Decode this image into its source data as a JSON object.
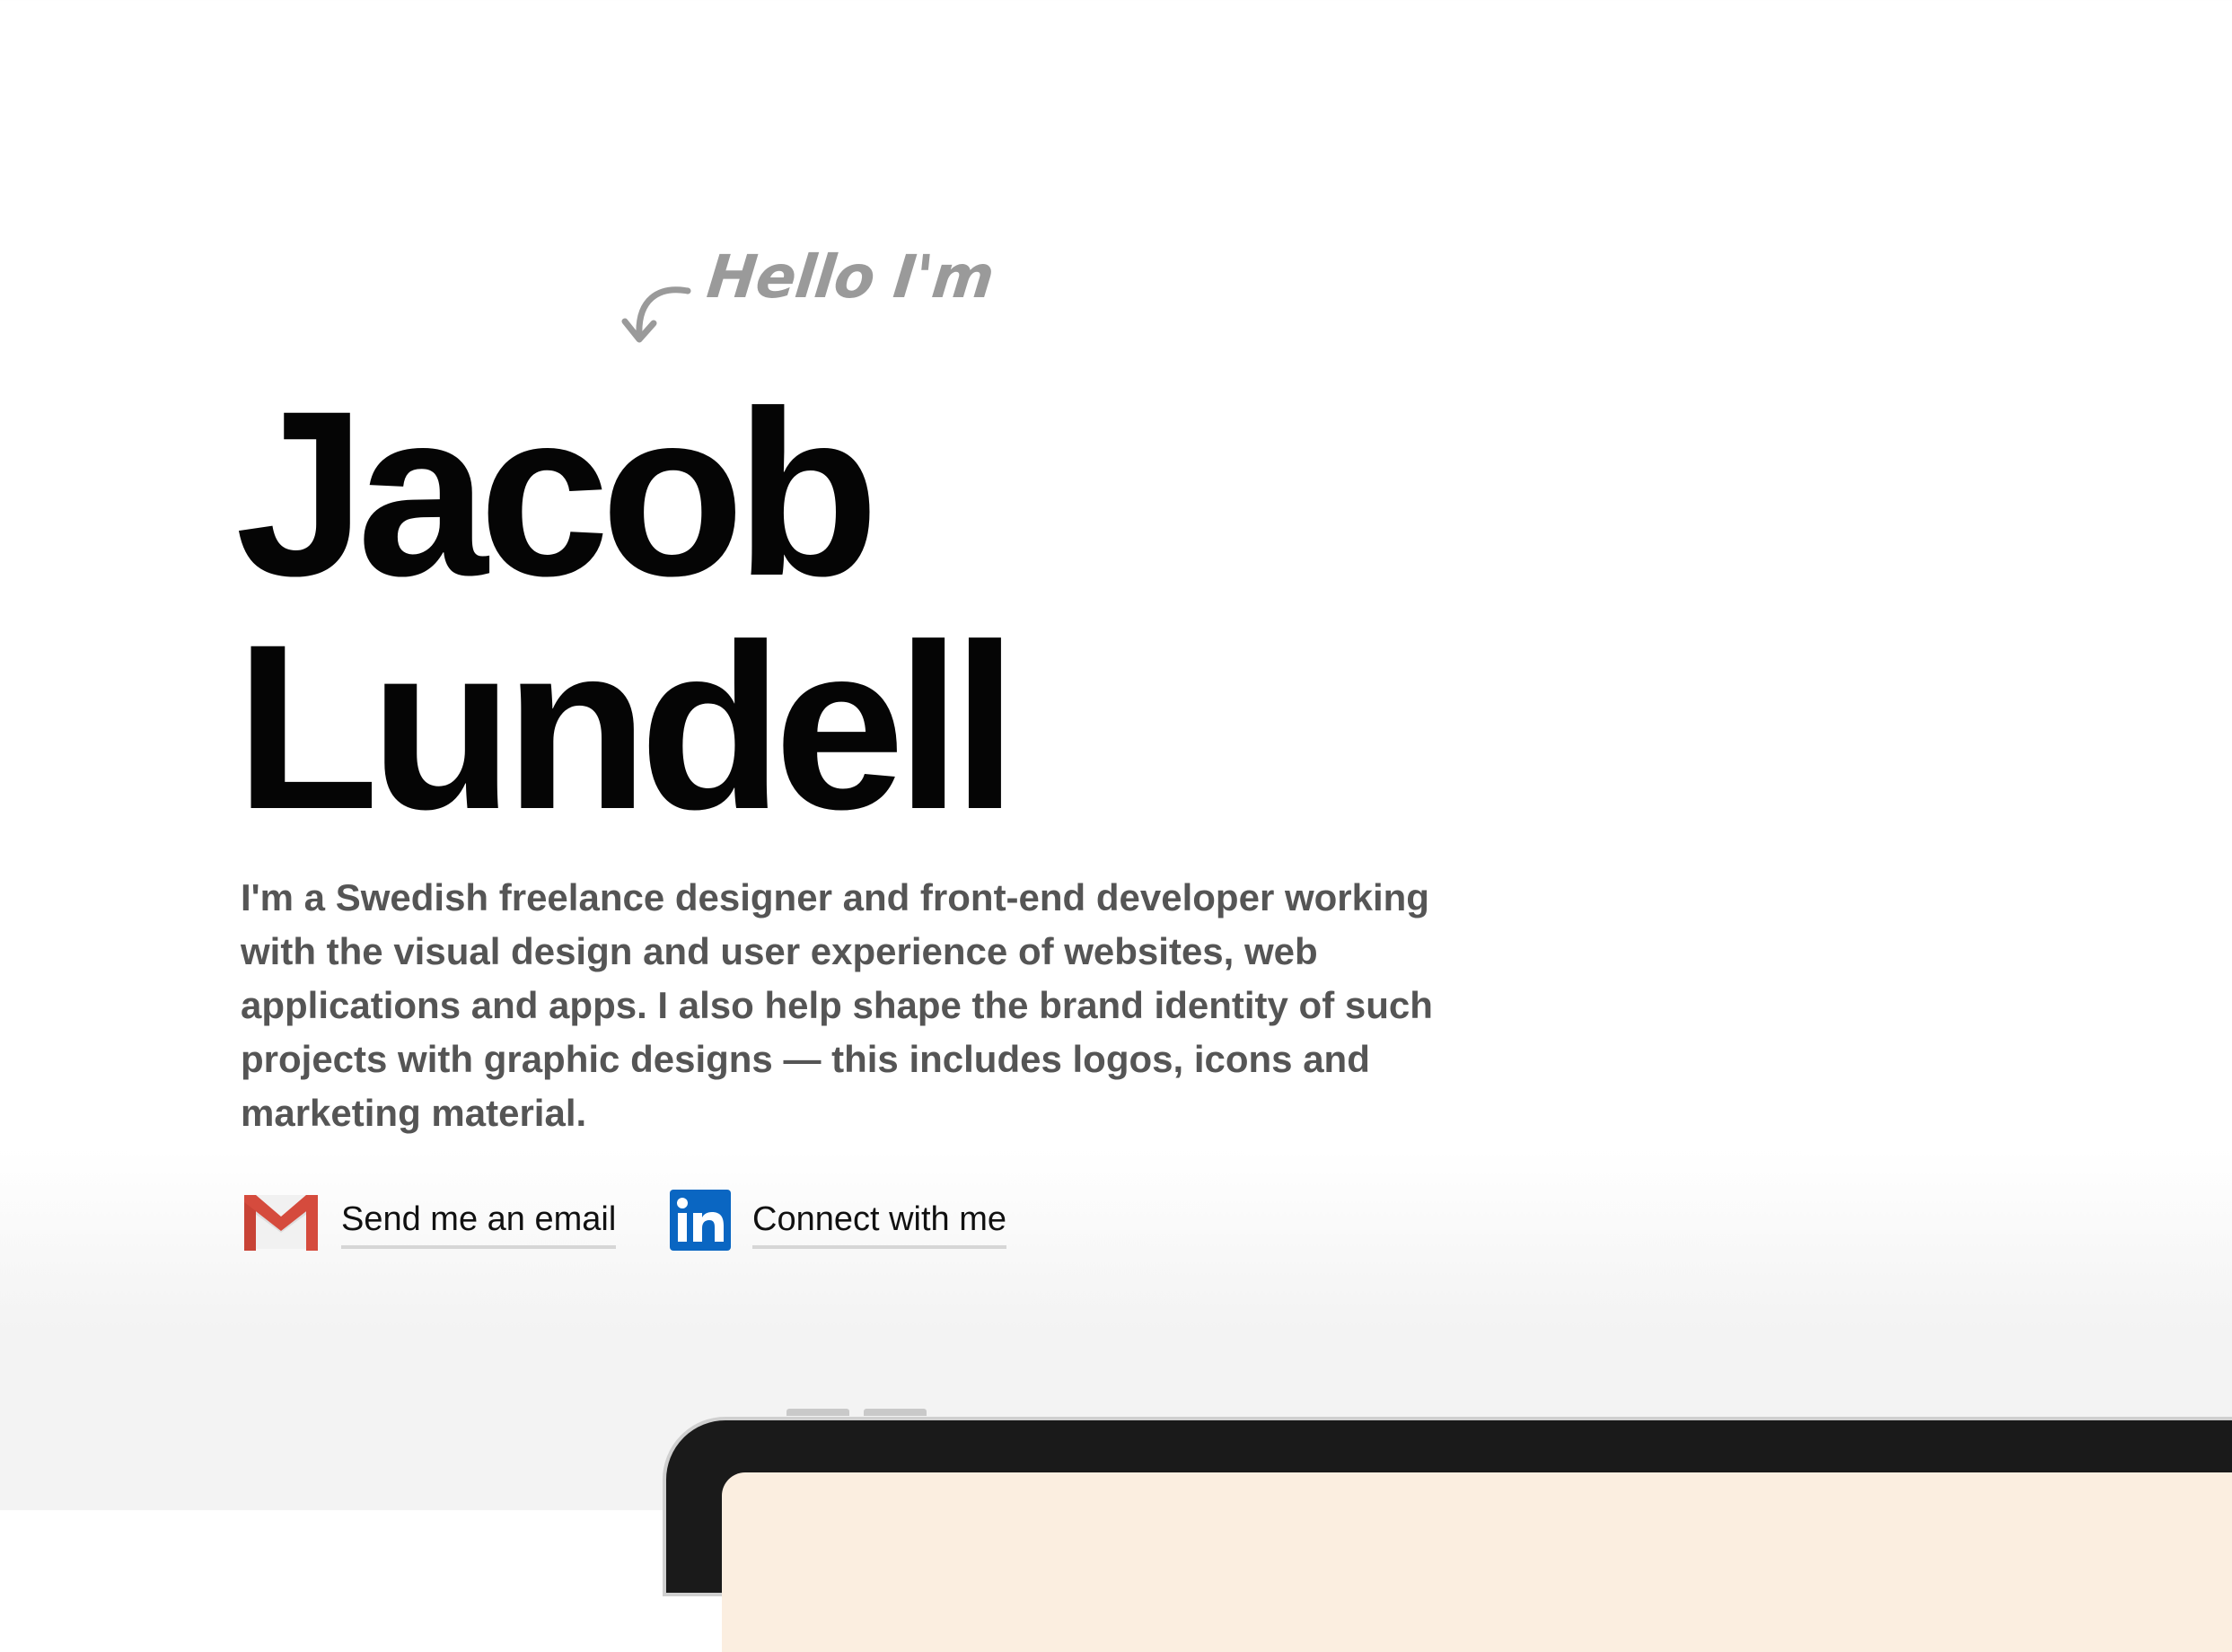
{
  "greeting": {
    "text": "Hello I'm",
    "color": "#9a9a9a"
  },
  "name": {
    "first": "Jacob",
    "last": "Lundell"
  },
  "bio": {
    "text": "I'm a Swedish freelance designer and front-end developer working with the visual design and user experience of websites, web applications and apps. I also help shape the brand identity of such projects with graphic designs — this includes logos, icons and marketing material."
  },
  "contacts": {
    "email": {
      "label": "Send me an email",
      "icon": "gmail-icon"
    },
    "linkedin": {
      "label": "Connect with me",
      "icon": "linkedin-icon",
      "brand_color": "#0a66c2"
    }
  },
  "colors": {
    "heading": "#050505",
    "body_text": "#555555",
    "underline": "#d6d6d6",
    "device_screen": "#fbeee0"
  }
}
